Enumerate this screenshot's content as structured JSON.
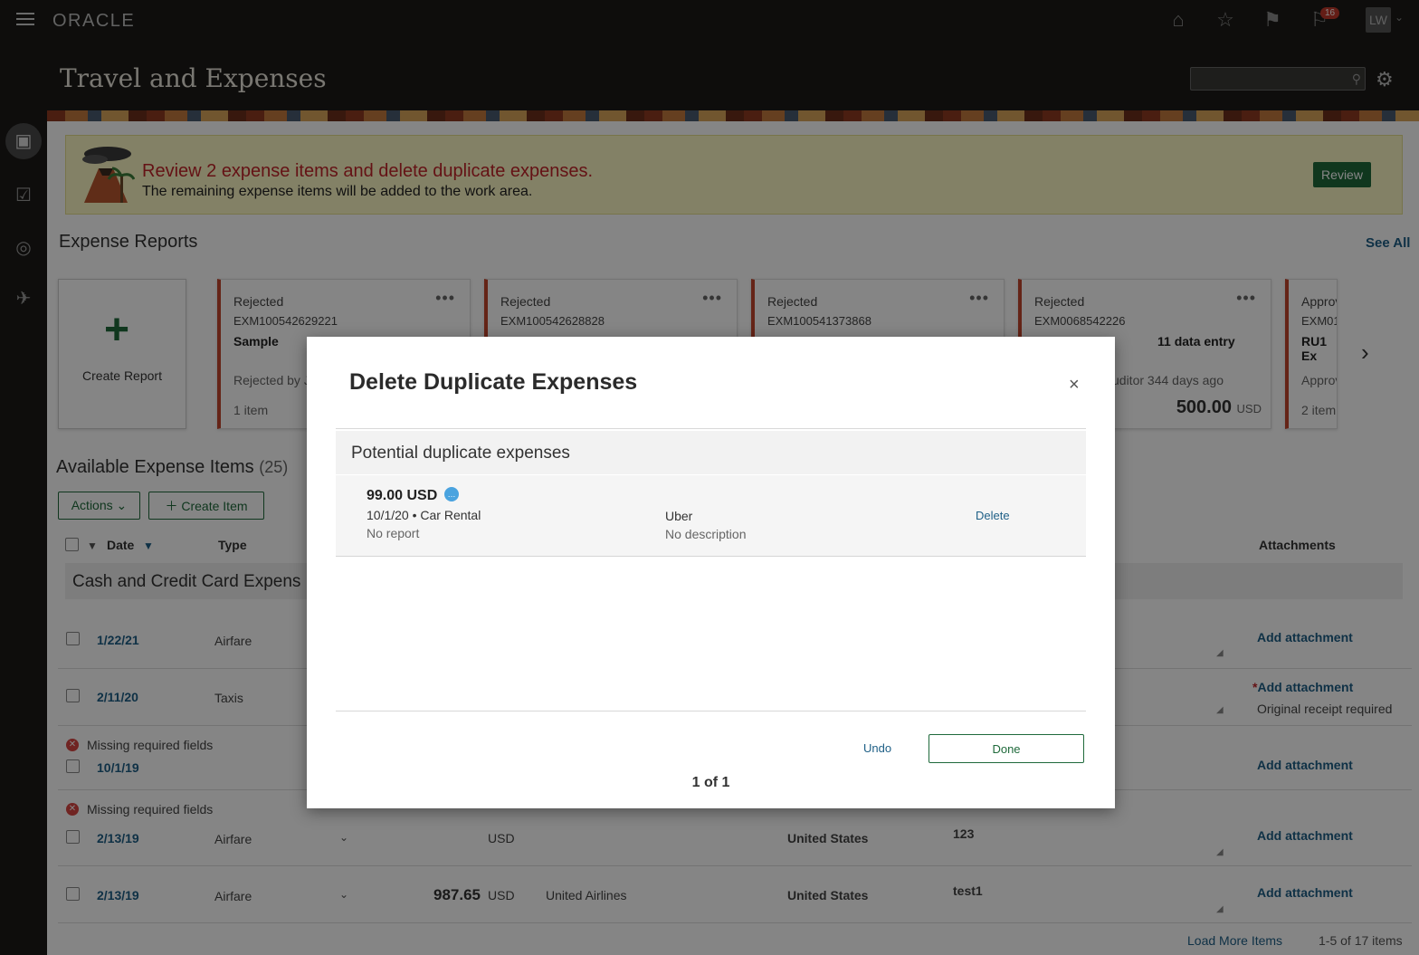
{
  "app": {
    "logo": "ORACLE",
    "title": "Travel and Expenses",
    "notification_count": "16",
    "avatar_initials": "LW",
    "search_placeholder": ""
  },
  "alert": {
    "title": "Review 2 expense items and delete duplicate expenses.",
    "text": "The remaining expense items will be added to the work area.",
    "button": "Review"
  },
  "expense_reports": {
    "title": "Expense Reports",
    "see_all": "See All",
    "create_label": "Create Report",
    "cards": [
      {
        "status": "Rejected",
        "id": "EXM100542629221",
        "name": "Sample",
        "sub": "Rejected by J",
        "items": "1 item",
        "amount": "",
        "currency": ""
      },
      {
        "status": "Rejected",
        "id": "EXM100542628828",
        "name": "",
        "sub": "",
        "items": "",
        "amount": "",
        "currency": ""
      },
      {
        "status": "Rejected",
        "id": "EXM100541373868",
        "name": "",
        "sub": "",
        "items": "",
        "amount": "",
        "currency": ""
      },
      {
        "status": "Rejected",
        "id": "EXM0068542226",
        "name": "11 data entry",
        "sub": "uditor 344 days ago",
        "items": "",
        "amount": "500.00",
        "currency": "USD"
      },
      {
        "status": "Approv",
        "id": "EXM01",
        "name": "RU1 Ex",
        "sub": "Approv",
        "items": "2 item",
        "amount": "",
        "currency": ""
      }
    ]
  },
  "available_items": {
    "title": "Available Expense Items",
    "count": "(25)",
    "actions_button": "Actions",
    "create_item_button": "Create Item",
    "columns": {
      "date": "Date",
      "type": "Type",
      "attachments": "Attachments"
    },
    "group_label": "Cash and Credit Card Expens",
    "rows": [
      {
        "date": "1/22/21",
        "type": "Airfare",
        "error": "",
        "amount": "",
        "currency": "",
        "merchant": "",
        "country": "",
        "desc": "",
        "attachment": "Add attachment",
        "note": ""
      },
      {
        "date": "2/11/20",
        "type": "Taxis",
        "error": "",
        "amount": "",
        "currency": "",
        "merchant": "",
        "country": "",
        "desc": "",
        "attachment": "Add attachment",
        "note": "Original receipt required"
      },
      {
        "date": "10/1/19",
        "type": "",
        "error": "Missing required fields",
        "amount": "",
        "currency": "",
        "merchant": "",
        "country": "",
        "desc": "",
        "attachment": "Add attachment",
        "note": ""
      },
      {
        "date": "2/13/19",
        "type": "Airfare",
        "error": "Missing required fields",
        "amount": "",
        "currency": "USD",
        "merchant": "",
        "country": "United States",
        "desc": "123",
        "attachment": "Add attachment",
        "note": ""
      },
      {
        "date": "2/13/19",
        "type": "Airfare",
        "error": "",
        "amount": "987.65",
        "currency": "USD",
        "merchant": "United Airlines",
        "country": "United States",
        "desc": "test1",
        "attachment": "Add attachment",
        "note": ""
      }
    ],
    "load_more": "Load More Items",
    "range": "1-5 of 17 items"
  },
  "dialog": {
    "title": "Delete Duplicate Expenses",
    "close": "×",
    "section_label": "Potential duplicate expenses",
    "item": {
      "amount": "99.00 USD",
      "meta": "10/1/20 • Car Rental",
      "report": "No report",
      "merchant": "Uber",
      "description": "No description",
      "delete": "Delete"
    },
    "undo": "Undo",
    "done": "Done",
    "pager": "1 of 1"
  }
}
